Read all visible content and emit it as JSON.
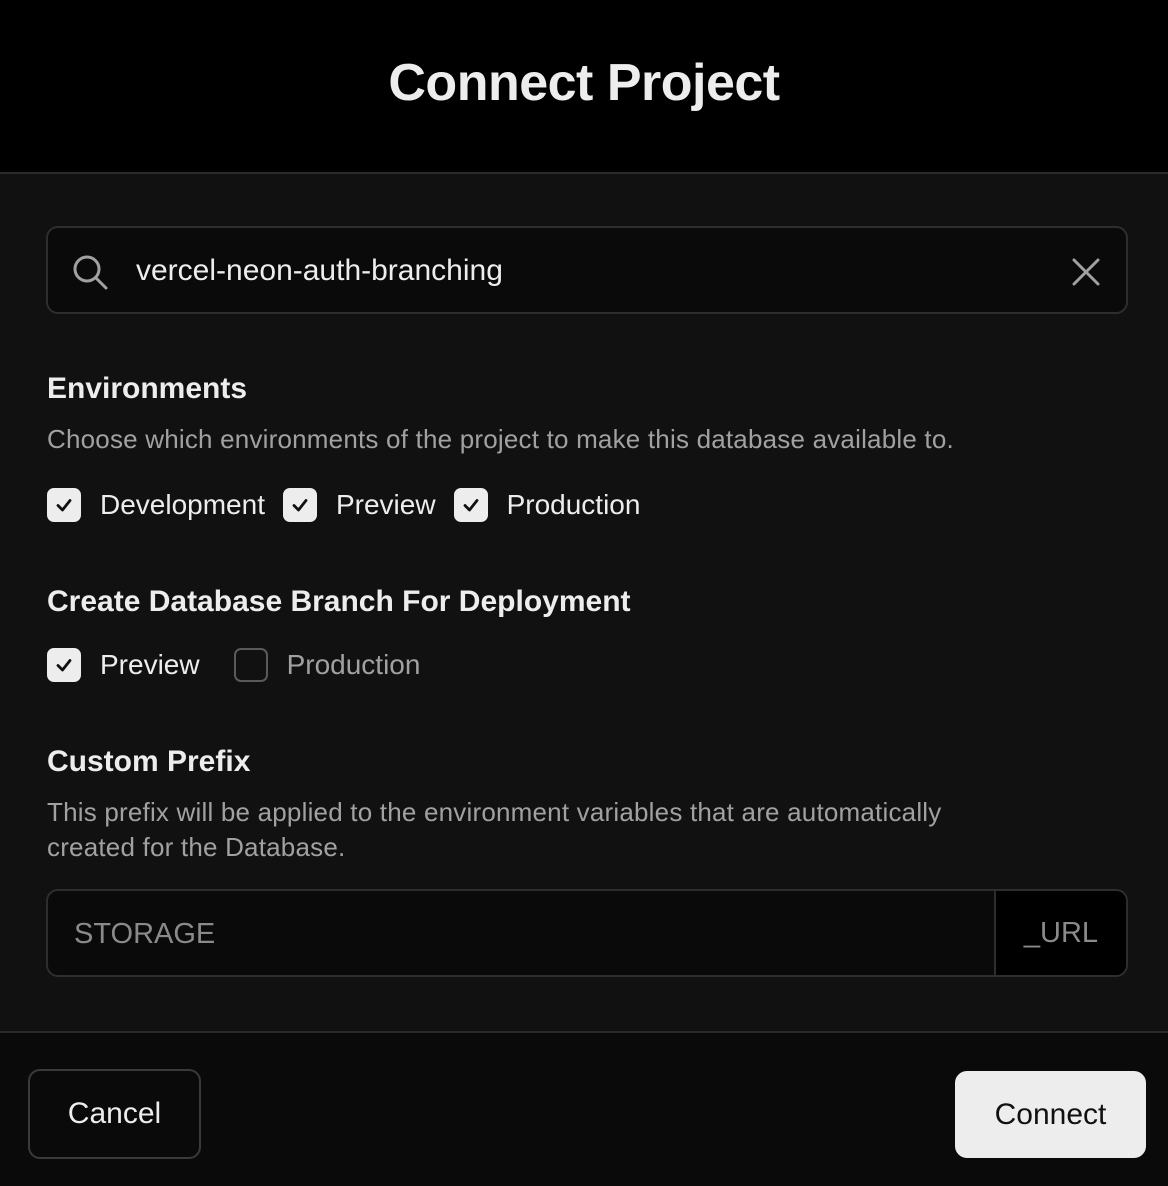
{
  "dialog": {
    "title": "Connect Project"
  },
  "search": {
    "value": "vercel-neon-auth-branching",
    "icon": "search-icon",
    "clear_icon": "close-icon"
  },
  "environments": {
    "title": "Environments",
    "description": "Choose which environments of the project to make this database available to.",
    "options": [
      {
        "label": "Development",
        "checked": true
      },
      {
        "label": "Preview",
        "checked": true
      },
      {
        "label": "Production",
        "checked": true
      }
    ]
  },
  "branching": {
    "title": "Create Database Branch For Deployment",
    "options": [
      {
        "label": "Preview",
        "checked": true
      },
      {
        "label": "Production",
        "checked": false
      }
    ]
  },
  "custom_prefix": {
    "title": "Custom Prefix",
    "description_line1": "This prefix will be applied to the environment variables that are automatically",
    "description_line2": "created for the Database.",
    "placeholder": "STORAGE",
    "value": "",
    "suffix": "_URL"
  },
  "footer": {
    "cancel_label": "Cancel",
    "connect_label": "Connect"
  },
  "colors": {
    "header_bg": "#000000",
    "body_bg": "#111111",
    "text": "#ededed",
    "muted_text": "#a1a1a1",
    "checkbox_checked": "#ededed",
    "primary_button_bg": "#ededed"
  }
}
